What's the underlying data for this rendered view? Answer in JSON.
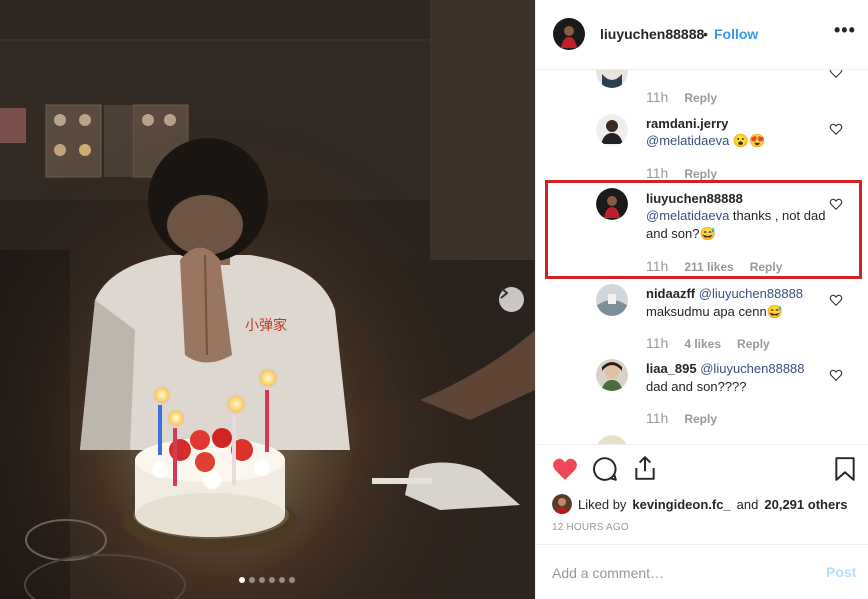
{
  "post": {
    "author": "liuyuchen88888",
    "separator": "•",
    "follow_label": "Follow",
    "more_label": "•••"
  },
  "carousel": {
    "next_label": "›",
    "total_slides": 6,
    "active_slide": 1
  },
  "comments": [
    {
      "user": "",
      "time": "11h",
      "reply_label": "Reply"
    },
    {
      "user": "ramdani.jerry",
      "mention": "@melatidaeva",
      "text": " 😮😍",
      "time": "11h",
      "reply_label": "Reply"
    },
    {
      "user": "liuyuchen88888",
      "mention": "@melatidaeva",
      "text": " thanks , not dad and son?😅",
      "time": "11h",
      "likes": "211 likes",
      "reply_label": "Reply"
    },
    {
      "user": "nidaazff",
      "mention": "@liuyuchen88888",
      "text": "maksudmu apa cenn😅",
      "time": "11h",
      "likes": "4 likes",
      "reply_label": "Reply"
    },
    {
      "user": "liaa_895",
      "mention": "@liuyuchen88888",
      "text": "dad and son????",
      "time": "11h",
      "reply_label": "Reply"
    }
  ],
  "likes_summary": {
    "prefix": "Liked by",
    "user": "kevingideon.fc_",
    "middle": "and",
    "count": "20,291 others"
  },
  "timestamp": "12 HOURS AGO",
  "add_comment": {
    "placeholder": "Add a comment…",
    "post_label": "Post"
  },
  "colors": {
    "accent": "#3897f0",
    "like_red": "#ed4956",
    "highlight_border": "#d32027"
  },
  "icons": [
    "heart-filled-icon",
    "comment-icon",
    "share-icon",
    "bookmark-icon",
    "heart-outline-icon",
    "chevron-right-icon"
  ]
}
